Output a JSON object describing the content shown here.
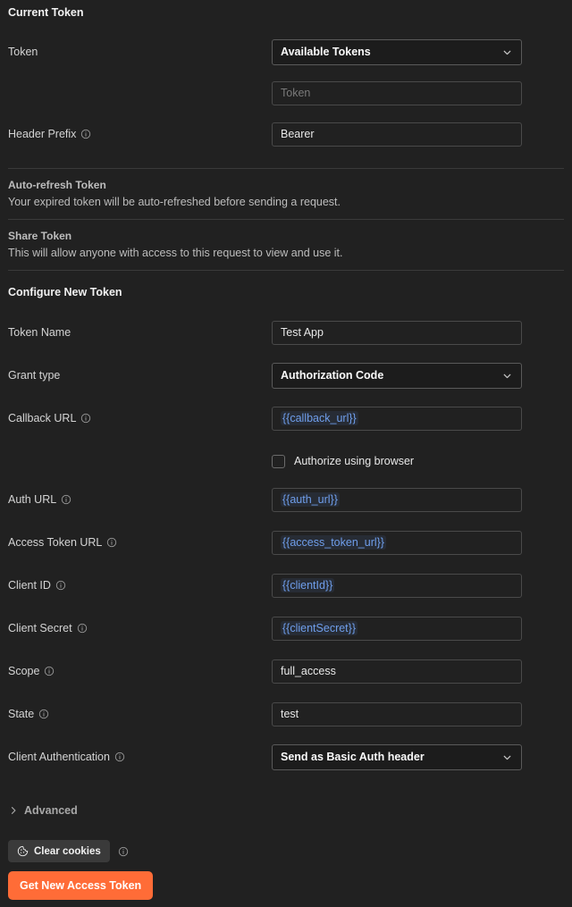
{
  "theme": {
    "background": "#212121",
    "accent": "#ff6c37",
    "variable_color": "#6f9eeb",
    "border": "#4a4a4a",
    "divider": "#3a3a3a"
  },
  "current_token": {
    "heading": "Current Token",
    "token": {
      "label": "Token",
      "select_value": "Available Tokens",
      "chevron_icon": "chevron-down-icon",
      "token_input_placeholder": "Token",
      "token_input_value": ""
    },
    "header_prefix": {
      "label": "Header Prefix",
      "info_icon": "info-circle-icon",
      "value": "Bearer"
    }
  },
  "auto_refresh": {
    "title": "Auto-refresh Token",
    "description": "Your expired token will be auto-refreshed before sending a request."
  },
  "share_token": {
    "title": "Share Token",
    "description": "This will allow anyone with access to this request to view and use it."
  },
  "configure": {
    "heading": "Configure New Token",
    "fields": [
      {
        "label": "Token Name",
        "info_icon": null,
        "type": "text",
        "value": "Test App",
        "is_variable": false
      },
      {
        "label": "Grant type",
        "info_icon": null,
        "type": "select",
        "value": "Authorization Code",
        "is_variable": false
      },
      {
        "label": "Callback URL",
        "info_icon": "info-circle-icon",
        "type": "text",
        "value": "{{callback_url}}",
        "is_variable": true
      },
      {
        "label": "Auth URL",
        "info_icon": "info-circle-icon",
        "type": "text",
        "value": "{{auth_url}}",
        "is_variable": true
      },
      {
        "label": "Access Token URL",
        "info_icon": "info-circle-icon",
        "type": "text",
        "value": "{{access_token_url}}",
        "is_variable": true
      },
      {
        "label": "Client ID",
        "info_icon": "info-circle-icon",
        "type": "text",
        "value": "{{clientId}}",
        "is_variable": true
      },
      {
        "label": "Client Secret",
        "info_icon": "info-circle-icon",
        "type": "text",
        "value": "{{clientSecret}}",
        "is_variable": true
      },
      {
        "label": "Scope",
        "info_icon": "info-circle-icon",
        "type": "text",
        "value": "full_access",
        "is_variable": false
      },
      {
        "label": "State",
        "info_icon": "info-circle-icon",
        "type": "text",
        "value": "test",
        "is_variable": false
      },
      {
        "label": "Client Authentication",
        "info_icon": "info-circle-icon",
        "type": "select",
        "value": "Send as Basic Auth header",
        "is_variable": false
      }
    ],
    "authorize_checkbox": {
      "label": "Authorize using browser",
      "checked": false
    }
  },
  "advanced": {
    "label": "Advanced",
    "chevron_icon": "chevron-right-icon",
    "expanded": false
  },
  "actions": {
    "clear_cookies": {
      "label": "Clear cookies",
      "icon": "cookie-icon",
      "info_icon": "info-circle-icon"
    },
    "get_token": {
      "label": "Get New Access Token"
    }
  }
}
